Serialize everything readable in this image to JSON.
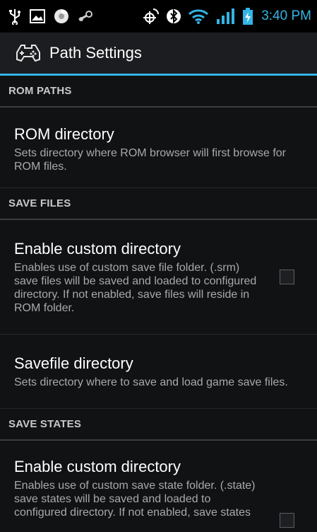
{
  "status_bar": {
    "time": "3:40 PM",
    "accent_color": "#33b5e5",
    "icons": [
      "usb-icon",
      "picture-icon",
      "chrome-icon",
      "steam-icon",
      "gps-icon",
      "bluetooth-icon",
      "wifi-icon",
      "signal-icon",
      "battery-charging-icon"
    ]
  },
  "action_bar": {
    "title": "Path Settings",
    "icon": "gamepad-icon"
  },
  "sections": {
    "rom_paths": {
      "header": "ROM PATHS",
      "rom_directory": {
        "title": "ROM directory",
        "summary": "Sets directory where ROM browser will first browse for ROM files."
      }
    },
    "save_files": {
      "header": "SAVE FILES",
      "enable_custom": {
        "title": "Enable custom directory",
        "summary": "Enables use of custom save file folder. (.srm) save files will be saved and loaded to configured directory. If not enabled, save files will reside in ROM folder.",
        "checked": false
      },
      "savefile_directory": {
        "title": "Savefile directory",
        "summary": "Sets directory where to save and load game save files."
      }
    },
    "save_states": {
      "header": "SAVE STATES",
      "enable_custom": {
        "title": "Enable custom directory",
        "summary": "Enables use of custom save state folder. (.state) save states will be saved and loaded to configured directory. If not enabled, save states",
        "checked": false
      }
    }
  }
}
